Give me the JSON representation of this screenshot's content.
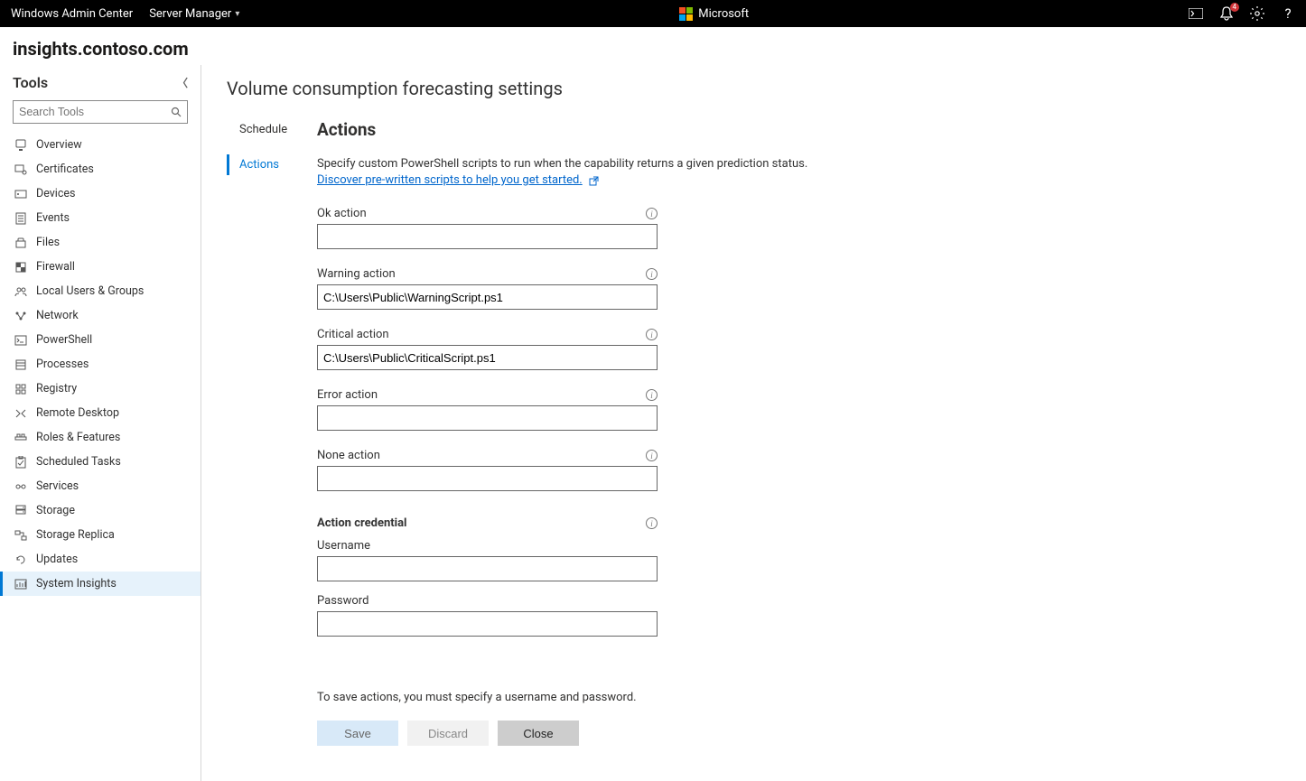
{
  "topbar": {
    "brand": "Windows Admin Center",
    "dropdown": "Server Manager",
    "center_label": "Microsoft",
    "notification_count": "4"
  },
  "server_name": "insights.contoso.com",
  "sidebar": {
    "title": "Tools",
    "search_placeholder": "Search Tools",
    "items": [
      {
        "label": "Overview"
      },
      {
        "label": "Certificates"
      },
      {
        "label": "Devices"
      },
      {
        "label": "Events"
      },
      {
        "label": "Files"
      },
      {
        "label": "Firewall"
      },
      {
        "label": "Local Users & Groups"
      },
      {
        "label": "Network"
      },
      {
        "label": "PowerShell"
      },
      {
        "label": "Processes"
      },
      {
        "label": "Registry"
      },
      {
        "label": "Remote Desktop"
      },
      {
        "label": "Roles & Features"
      },
      {
        "label": "Scheduled Tasks"
      },
      {
        "label": "Services"
      },
      {
        "label": "Storage"
      },
      {
        "label": "Storage Replica"
      },
      {
        "label": "Updates"
      },
      {
        "label": "System Insights"
      }
    ],
    "active_index": 18
  },
  "page": {
    "title": "Volume consumption forecasting settings",
    "tabs": [
      {
        "label": "Schedule"
      },
      {
        "label": "Actions"
      }
    ],
    "active_tab": 1,
    "section_heading": "Actions",
    "description": "Specify custom PowerShell scripts to run when the capability returns a given prediction status.",
    "link_text": "Discover pre-written scripts to help you get started.",
    "fields": {
      "ok": {
        "label": "Ok action",
        "value": ""
      },
      "warning": {
        "label": "Warning action",
        "value": "C:\\Users\\Public\\WarningScript.ps1"
      },
      "critical": {
        "label": "Critical action",
        "value": "C:\\Users\\Public\\CriticalScript.ps1"
      },
      "error": {
        "label": "Error action",
        "value": ""
      },
      "none": {
        "label": "None action",
        "value": ""
      }
    },
    "credential": {
      "heading": "Action credential",
      "username_label": "Username",
      "username_value": "",
      "password_label": "Password",
      "password_value": ""
    },
    "footnote": "To save actions, you must specify a username and password.",
    "buttons": {
      "save": "Save",
      "discard": "Discard",
      "close": "Close"
    }
  }
}
